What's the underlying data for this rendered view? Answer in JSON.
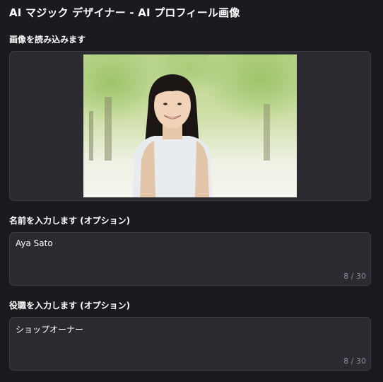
{
  "window": {
    "title": "AI マジック デザイナー - AI プロフィール画像"
  },
  "image_section": {
    "label": "画像を読み込みます"
  },
  "name_section": {
    "label": "名前を入力します (オプション)",
    "value": "Aya Sato",
    "counter": "8 / 30"
  },
  "role_section": {
    "label": "役職を入力します (オプション)",
    "value": "ショップオーナー",
    "counter": "8 / 30"
  }
}
